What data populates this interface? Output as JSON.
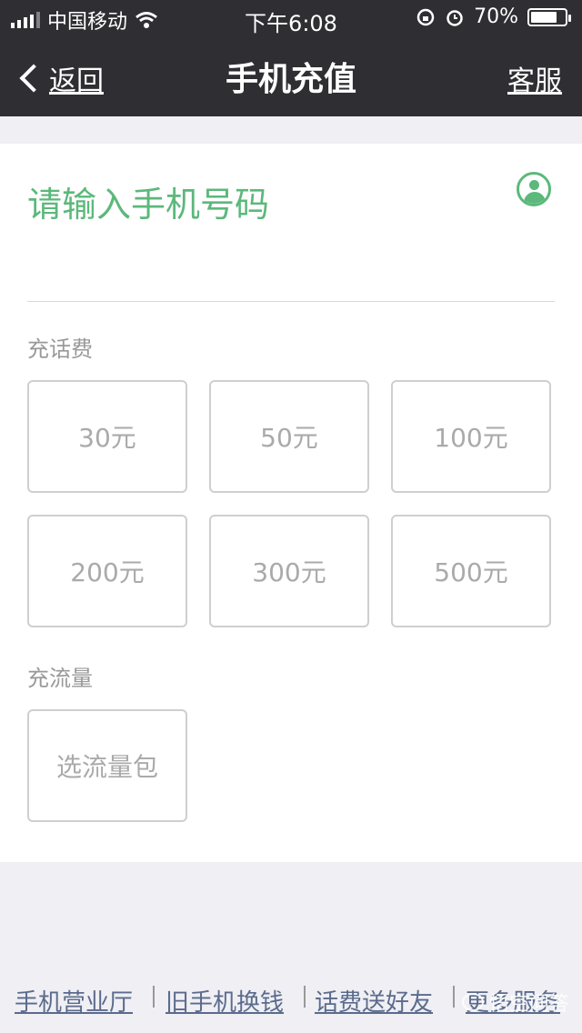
{
  "status_bar": {
    "carrier": "中国移动",
    "time": "下午6:08",
    "battery": "70%"
  },
  "nav": {
    "back_label": "返回",
    "title": "手机充值",
    "service_label": "客服"
  },
  "phone_input": {
    "placeholder": "请输入手机号码"
  },
  "topup": {
    "label": "充话费",
    "options": [
      "30元",
      "50元",
      "100元",
      "200元",
      "300元",
      "500元"
    ]
  },
  "data": {
    "label": "充流量",
    "option": "选流量包"
  },
  "footer": {
    "links": [
      "手机营业厅",
      "旧手机换钱",
      "话费送好友",
      "更多服务"
    ]
  },
  "watermark": "悟空问答"
}
